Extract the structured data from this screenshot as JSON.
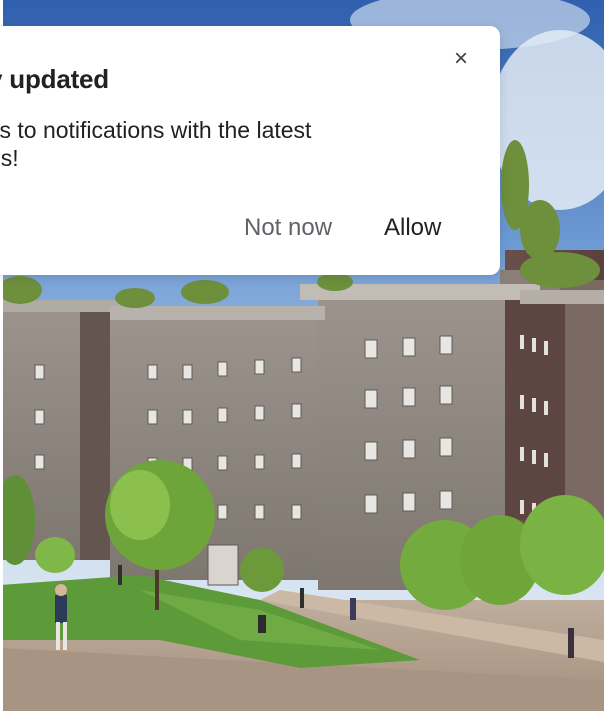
{
  "notification": {
    "title": "y updated",
    "body": "ks to notifications with the latest\nes!",
    "close_glyph": "×",
    "not_now_label": "Not now",
    "allow_label": "Allow"
  },
  "background": {
    "sky_color": "#3a6fb8",
    "building_color": "#8e8a86",
    "grass_color": "#5a9a3a",
    "pavement_color": "#b9a898"
  }
}
